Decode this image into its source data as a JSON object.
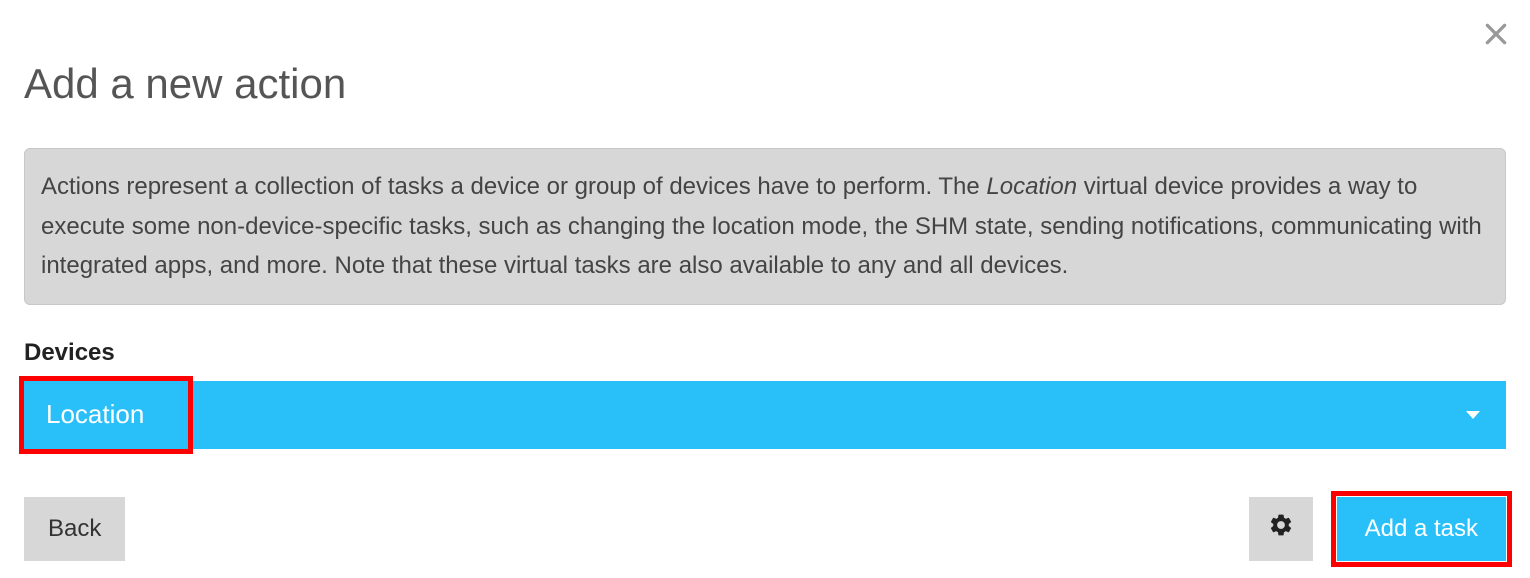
{
  "header": {
    "title": "Add a new action"
  },
  "info": {
    "text_before_em": "Actions represent a collection of tasks a device or group of devices have to perform. The ",
    "em_text": "Location",
    "text_after_em": " virtual device provides a way to execute some non-device-specific tasks, such as changing the location mode, the SHM state, sending notifications, communicating with integrated apps, and more. Note that these virtual tasks are also available to any and all devices."
  },
  "devices": {
    "label": "Devices",
    "selected": "Location"
  },
  "footer": {
    "back_label": "Back",
    "add_task_label": "Add a task"
  }
}
